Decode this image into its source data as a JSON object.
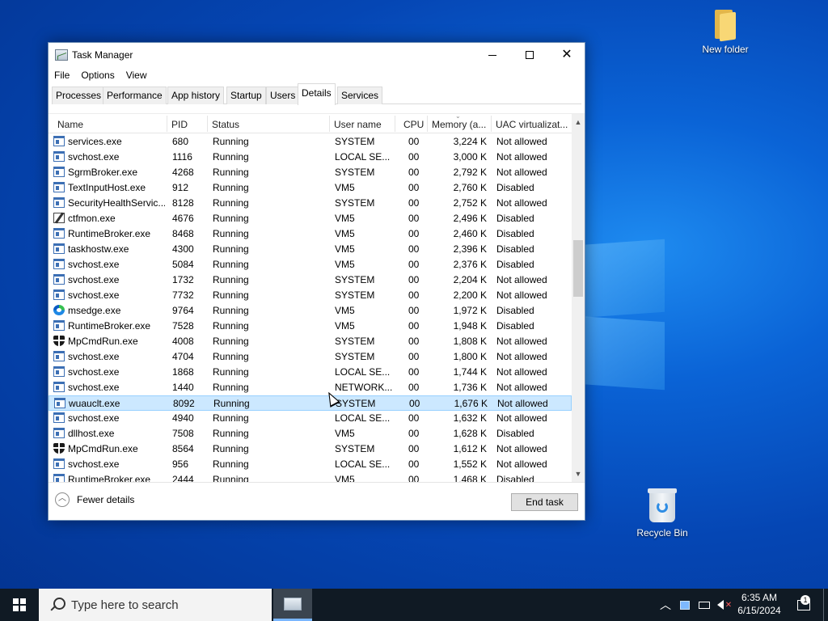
{
  "desktop": {
    "icons": [
      {
        "label": "New folder",
        "icon": "folder-icon"
      },
      {
        "label": "Recycle Bin",
        "icon": "recycle-bin-icon"
      }
    ]
  },
  "window": {
    "title": "Task Manager",
    "menu": [
      "File",
      "Options",
      "View"
    ],
    "tabs": [
      "Processes",
      "Performance",
      "App history",
      "Startup",
      "Users",
      "Details",
      "Services"
    ],
    "active_tab": "Details",
    "columns": [
      "Name",
      "PID",
      "Status",
      "User name",
      "CPU",
      "Memory (a...",
      "UAC virtualizat..."
    ],
    "rows": [
      {
        "name": "services.exe",
        "pid": "680",
        "status": "Running",
        "user": "SYSTEM",
        "cpu": "00",
        "memory": "3,224 K",
        "uac": "Not allowed",
        "icon": "exe"
      },
      {
        "name": "svchost.exe",
        "pid": "1116",
        "status": "Running",
        "user": "LOCAL SE...",
        "cpu": "00",
        "memory": "3,000 K",
        "uac": "Not allowed",
        "icon": "exe"
      },
      {
        "name": "SgrmBroker.exe",
        "pid": "4268",
        "status": "Running",
        "user": "SYSTEM",
        "cpu": "00",
        "memory": "2,792 K",
        "uac": "Not allowed",
        "icon": "exe"
      },
      {
        "name": "TextInputHost.exe",
        "pid": "912",
        "status": "Running",
        "user": "VM5",
        "cpu": "00",
        "memory": "2,760 K",
        "uac": "Disabled",
        "icon": "exe"
      },
      {
        "name": "SecurityHealthServic...",
        "pid": "8128",
        "status": "Running",
        "user": "SYSTEM",
        "cpu": "00",
        "memory": "2,752 K",
        "uac": "Not allowed",
        "icon": "exe"
      },
      {
        "name": "ctfmon.exe",
        "pid": "4676",
        "status": "Running",
        "user": "VM5",
        "cpu": "00",
        "memory": "2,496 K",
        "uac": "Disabled",
        "icon": "pen"
      },
      {
        "name": "RuntimeBroker.exe",
        "pid": "8468",
        "status": "Running",
        "user": "VM5",
        "cpu": "00",
        "memory": "2,460 K",
        "uac": "Disabled",
        "icon": "exe"
      },
      {
        "name": "taskhostw.exe",
        "pid": "4300",
        "status": "Running",
        "user": "VM5",
        "cpu": "00",
        "memory": "2,396 K",
        "uac": "Disabled",
        "icon": "exe"
      },
      {
        "name": "svchost.exe",
        "pid": "5084",
        "status": "Running",
        "user": "VM5",
        "cpu": "00",
        "memory": "2,376 K",
        "uac": "Disabled",
        "icon": "exe"
      },
      {
        "name": "svchost.exe",
        "pid": "1732",
        "status": "Running",
        "user": "SYSTEM",
        "cpu": "00",
        "memory": "2,204 K",
        "uac": "Not allowed",
        "icon": "exe"
      },
      {
        "name": "svchost.exe",
        "pid": "7732",
        "status": "Running",
        "user": "SYSTEM",
        "cpu": "00",
        "memory": "2,200 K",
        "uac": "Not allowed",
        "icon": "exe"
      },
      {
        "name": "msedge.exe",
        "pid": "9764",
        "status": "Running",
        "user": "VM5",
        "cpu": "00",
        "memory": "1,972 K",
        "uac": "Disabled",
        "icon": "edge"
      },
      {
        "name": "RuntimeBroker.exe",
        "pid": "7528",
        "status": "Running",
        "user": "VM5",
        "cpu": "00",
        "memory": "1,948 K",
        "uac": "Disabled",
        "icon": "exe"
      },
      {
        "name": "MpCmdRun.exe",
        "pid": "4008",
        "status": "Running",
        "user": "SYSTEM",
        "cpu": "00",
        "memory": "1,808 K",
        "uac": "Not allowed",
        "icon": "shield"
      },
      {
        "name": "svchost.exe",
        "pid": "4704",
        "status": "Running",
        "user": "SYSTEM",
        "cpu": "00",
        "memory": "1,800 K",
        "uac": "Not allowed",
        "icon": "exe"
      },
      {
        "name": "svchost.exe",
        "pid": "1868",
        "status": "Running",
        "user": "LOCAL SE...",
        "cpu": "00",
        "memory": "1,744 K",
        "uac": "Not allowed",
        "icon": "exe"
      },
      {
        "name": "svchost.exe",
        "pid": "1440",
        "status": "Running",
        "user": "NETWORK...",
        "cpu": "00",
        "memory": "1,736 K",
        "uac": "Not allowed",
        "icon": "exe"
      },
      {
        "name": "wuauclt.exe",
        "pid": "8092",
        "status": "Running",
        "user": "SYSTEM",
        "cpu": "00",
        "memory": "1,676 K",
        "uac": "Not allowed",
        "icon": "exe",
        "selected": true
      },
      {
        "name": "svchost.exe",
        "pid": "4940",
        "status": "Running",
        "user": "LOCAL SE...",
        "cpu": "00",
        "memory": "1,632 K",
        "uac": "Not allowed",
        "icon": "exe"
      },
      {
        "name": "dllhost.exe",
        "pid": "7508",
        "status": "Running",
        "user": "VM5",
        "cpu": "00",
        "memory": "1,628 K",
        "uac": "Disabled",
        "icon": "exe"
      },
      {
        "name": "MpCmdRun.exe",
        "pid": "8564",
        "status": "Running",
        "user": "SYSTEM",
        "cpu": "00",
        "memory": "1,612 K",
        "uac": "Not allowed",
        "icon": "shield"
      },
      {
        "name": "svchost.exe",
        "pid": "956",
        "status": "Running",
        "user": "LOCAL SE...",
        "cpu": "00",
        "memory": "1,552 K",
        "uac": "Not allowed",
        "icon": "exe"
      },
      {
        "name": "RuntimeBroker.exe",
        "pid": "2444",
        "status": "Running",
        "user": "VM5",
        "cpu": "00",
        "memory": "1,468 K",
        "uac": "Disabled",
        "icon": "exe"
      }
    ],
    "footer": {
      "fewer_details": "Fewer details",
      "end_task": "End task"
    }
  },
  "taskbar": {
    "search_placeholder": "Type here to search",
    "time": "6:35 AM",
    "date": "6/15/2024",
    "notification_count": "1"
  }
}
